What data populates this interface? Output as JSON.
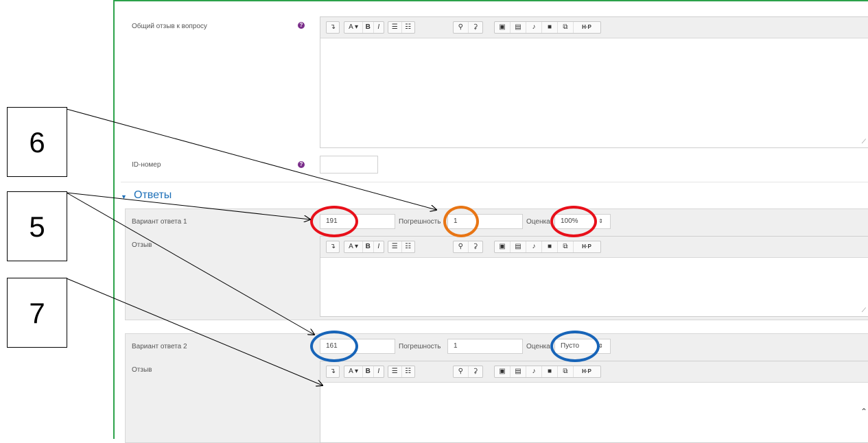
{
  "general_feedback": {
    "label": "Общий отзыв к вопросу",
    "help": "?"
  },
  "id_number": {
    "label": "ID-номер",
    "help": "?",
    "value": ""
  },
  "section": {
    "title": "Ответы"
  },
  "editor_toolbar": [
    {
      "icon": "collapse-icon",
      "glyph": "↴"
    },
    {
      "icon": "font-color-icon",
      "glyph": "A ▾"
    },
    {
      "icon": "bold-icon",
      "glyph": "B"
    },
    {
      "icon": "italic-icon",
      "glyph": "I"
    },
    {
      "icon": "unordered-list-icon",
      "glyph": "☰"
    },
    {
      "icon": "ordered-list-icon",
      "glyph": "☷"
    },
    {
      "icon": "link-icon",
      "glyph": "⚲"
    },
    {
      "icon": "unlink-icon",
      "glyph": "⚳"
    },
    {
      "icon": "image-icon",
      "glyph": "▣"
    },
    {
      "icon": "media-icon",
      "glyph": "▤"
    },
    {
      "icon": "record-audio-icon",
      "glyph": "♪"
    },
    {
      "icon": "record-video-icon",
      "glyph": "■"
    },
    {
      "icon": "manage-files-icon",
      "glyph": "⧉"
    },
    {
      "icon": "h5p-icon",
      "glyph": "H·P"
    }
  ],
  "answers": [
    {
      "label": "Вариант ответа 1",
      "answer": "191",
      "tolerance_label": "Погрешность",
      "tolerance": "1",
      "grade_label": "Оценка",
      "grade": "100%",
      "feedback_label": "Отзыв"
    },
    {
      "label": "Вариант ответа 2",
      "answer": "161",
      "tolerance_label": "Погрешность",
      "tolerance": "1",
      "grade_label": "Оценка",
      "grade": "Пусто",
      "feedback_label": "Отзыв"
    }
  ],
  "callouts": [
    "6",
    "5",
    "7"
  ],
  "colors": {
    "red": "#e8101a",
    "orange": "#e87514",
    "blue": "#1764b8",
    "green": "#2ca24a"
  }
}
